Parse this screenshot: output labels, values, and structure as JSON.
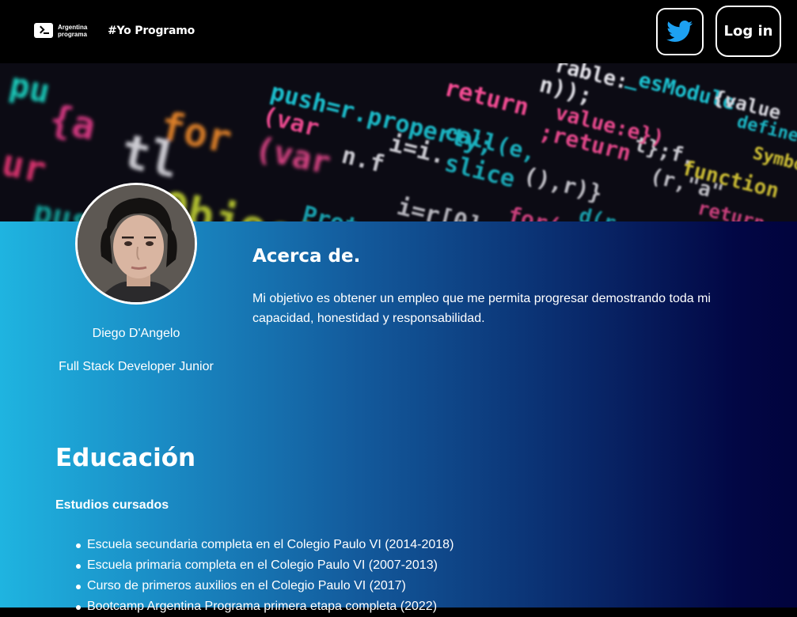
{
  "header": {
    "logo_line1": "Argentina",
    "logo_line2": "programa",
    "hashtag": "#Yo Programo",
    "login_label": "Log in",
    "twitter_color": "#1da1f2"
  },
  "profile": {
    "name": "Diego D'Angelo",
    "role": "Full Stack Developer Junior"
  },
  "about": {
    "title": "Acerca de.",
    "text": "Mi objetivo es obtener un empleo que me permita progresar demostrando toda mi capacidad, honestidad y responsabilidad."
  },
  "education": {
    "title": "Educación",
    "subtitle": "Estudios cursados",
    "items": [
      "Escuela secundaria completa en el Colegio Paulo VI (2014-2018)",
      "Escuela primaria completa en el Colegio Paulo VI (2007-2013)",
      "Curso de primeros auxilios en el Colegio Paulo VI (2017)",
      "Bootcamp Argentina Programa primera etapa completa (2022)"
    ]
  },
  "banner": {
    "code_text": [
      "able:_esModule{value:e})",
      "push=r.property;return n)",
      "Object(var);return e};",
      "n.f i=i.slice().call(e,r)}",
      "Proto function(r,a,p)"
    ]
  },
  "colors": {
    "gradient_start": "#1fb4e0",
    "gradient_end": "#01033d",
    "header_bg": "#000000"
  }
}
